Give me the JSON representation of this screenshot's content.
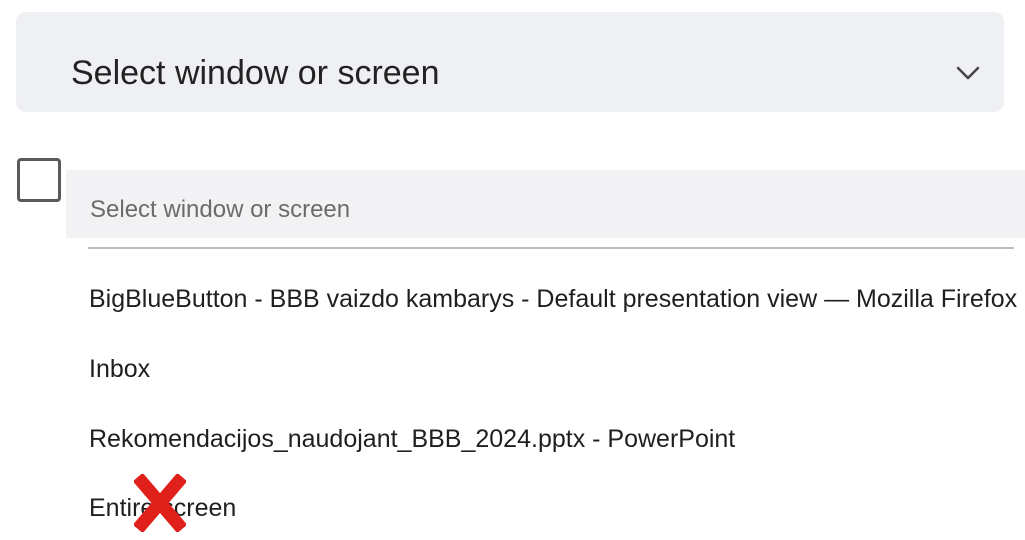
{
  "select": {
    "label": "Select window or screen",
    "icon": "chevron-down-icon"
  },
  "checkbox": {
    "checked": false
  },
  "dropdown": {
    "placeholder": "Select window or screen",
    "options": [
      "BigBlueButton - BBB vaizdo kambarys - Default presentation view — Mozilla Firefox",
      "Inbox",
      "Rekomendacijos_naudojant_BBB_2024.pptx - PowerPoint",
      "Entire screen"
    ]
  },
  "overlay": {
    "icon": "red-x-mark-icon",
    "color": "#e0201b"
  }
}
